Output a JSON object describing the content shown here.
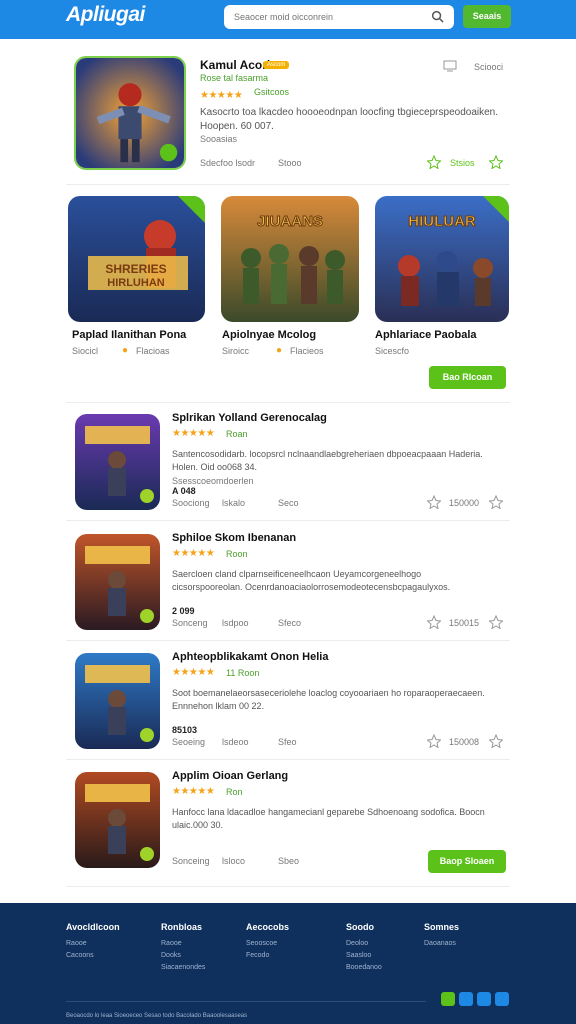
{
  "header": {
    "logo": "Apliugai",
    "search_placeholder": "Seaocer moid oicconrein",
    "button_label": "Seaais"
  },
  "featured": {
    "title": "Kamul Acori",
    "badge": "Ascom",
    "dev": "Rose tal fasarma",
    "rating_label": "Gsitcoos",
    "desc": "Kasocrto toa lkacdeo hoooeodnpan loocfing tbgieceprspeodoaiken. Hoopen. 60 007.",
    "desc2": "Sooasias",
    "action_top": "Sciooci",
    "meta1": "Sdecfoo lsodr",
    "meta2": "Stooo",
    "action_count": "Stsios",
    "colors": {
      "accent": "#52b830",
      "brand": "#1e88e5"
    }
  },
  "cards": [
    {
      "title": "Paplad Ilanithan Pona",
      "sub1": "Siocicl",
      "sub2": "Flacioas",
      "art": "Shrreries Hirluhan"
    },
    {
      "title": "Apiolnyae Mcolog",
      "sub1": "Siroicc",
      "sub2": "Flacieos",
      "art": "Jiuaans"
    },
    {
      "title": "Aphlariace Paobala",
      "sub1": "Sicescfo",
      "sub2": "",
      "art": "Hiuluar"
    }
  ],
  "cards_button": "Bao Rlcoan",
  "list": [
    {
      "title": "Splrikan Yolland Gerenocalag",
      "rating": "Roan",
      "desc": "Santencosodidarb. locopsrcl nclnaandlaebgreheriaen dbpoeacpaaan Haderia. Holen. Oid oo068 34.",
      "desc2": "Ssesscoeomdoerlen",
      "price": "A 048",
      "meta1": "Soociong",
      "meta2": "lskalo",
      "meta3": "Seco",
      "count": "150000",
      "art": "Halurak"
    },
    {
      "title": "Sphiloe Skom Ibenanan",
      "rating": "Roon",
      "desc": "Saercloen cland clparnseificeneelhcaon Ueyamcorgeneelhogo cicsorspooreolan. Ocenrdanoaciaolorrosemodeotecensbcpagaulyxos.",
      "desc2": "",
      "price": "2 099",
      "meta1": "Sonceng",
      "meta2": "lsdpoo",
      "meta3": "Sfeco",
      "count": "150015",
      "art": "Hulidak"
    },
    {
      "title": "Aphteopblikakamt Onon Helia",
      "rating": "11 Roon",
      "desc": "Soot boemanelaeorsaseceriolehe loaclog coyooariaen ho roparaoperaecaeen. Ennnehon lklam 00 22.",
      "desc2": "",
      "price": "85103",
      "meta1": "Seoeing",
      "meta2": "lsdeoo",
      "meta3": "Sfeo",
      "count": "150008",
      "art": "Hiliala"
    },
    {
      "title": "Applim Oioan Gerlang",
      "rating": "Ron",
      "desc": "Hanfocc lana ldacadloe hangamecianl geparebe Sdhoenoang sodofica. Boocn ulaic.000 30.",
      "desc2": "",
      "price": "",
      "meta1": "Sonceing",
      "meta2": "lsloco",
      "meta3": "Sbeo",
      "count": "",
      "art": "Metslis",
      "button": "Baop Sloaen"
    }
  ],
  "footer": {
    "cols": [
      {
        "h": "Avocldlcoon",
        "links": [
          "Raooe",
          "Cacoons"
        ]
      },
      {
        "h": "Ronbloas",
        "links": [
          "Raooe",
          "Dooks",
          "Siacaenondes"
        ]
      },
      {
        "h": "Aecocobs",
        "links": [
          "Seooscoe",
          "Fecodo"
        ]
      },
      {
        "h": "Soodo",
        "links": [
          "Deoloo",
          "Saasloo",
          "Booedanoo"
        ]
      },
      {
        "h": "Somnes",
        "links": [
          "Daoanaos"
        ]
      }
    ],
    "copyright": "Beoaocdo lo leaa Sioeoeceo Sesao todo Bacolado Baaoolesaaseas"
  }
}
